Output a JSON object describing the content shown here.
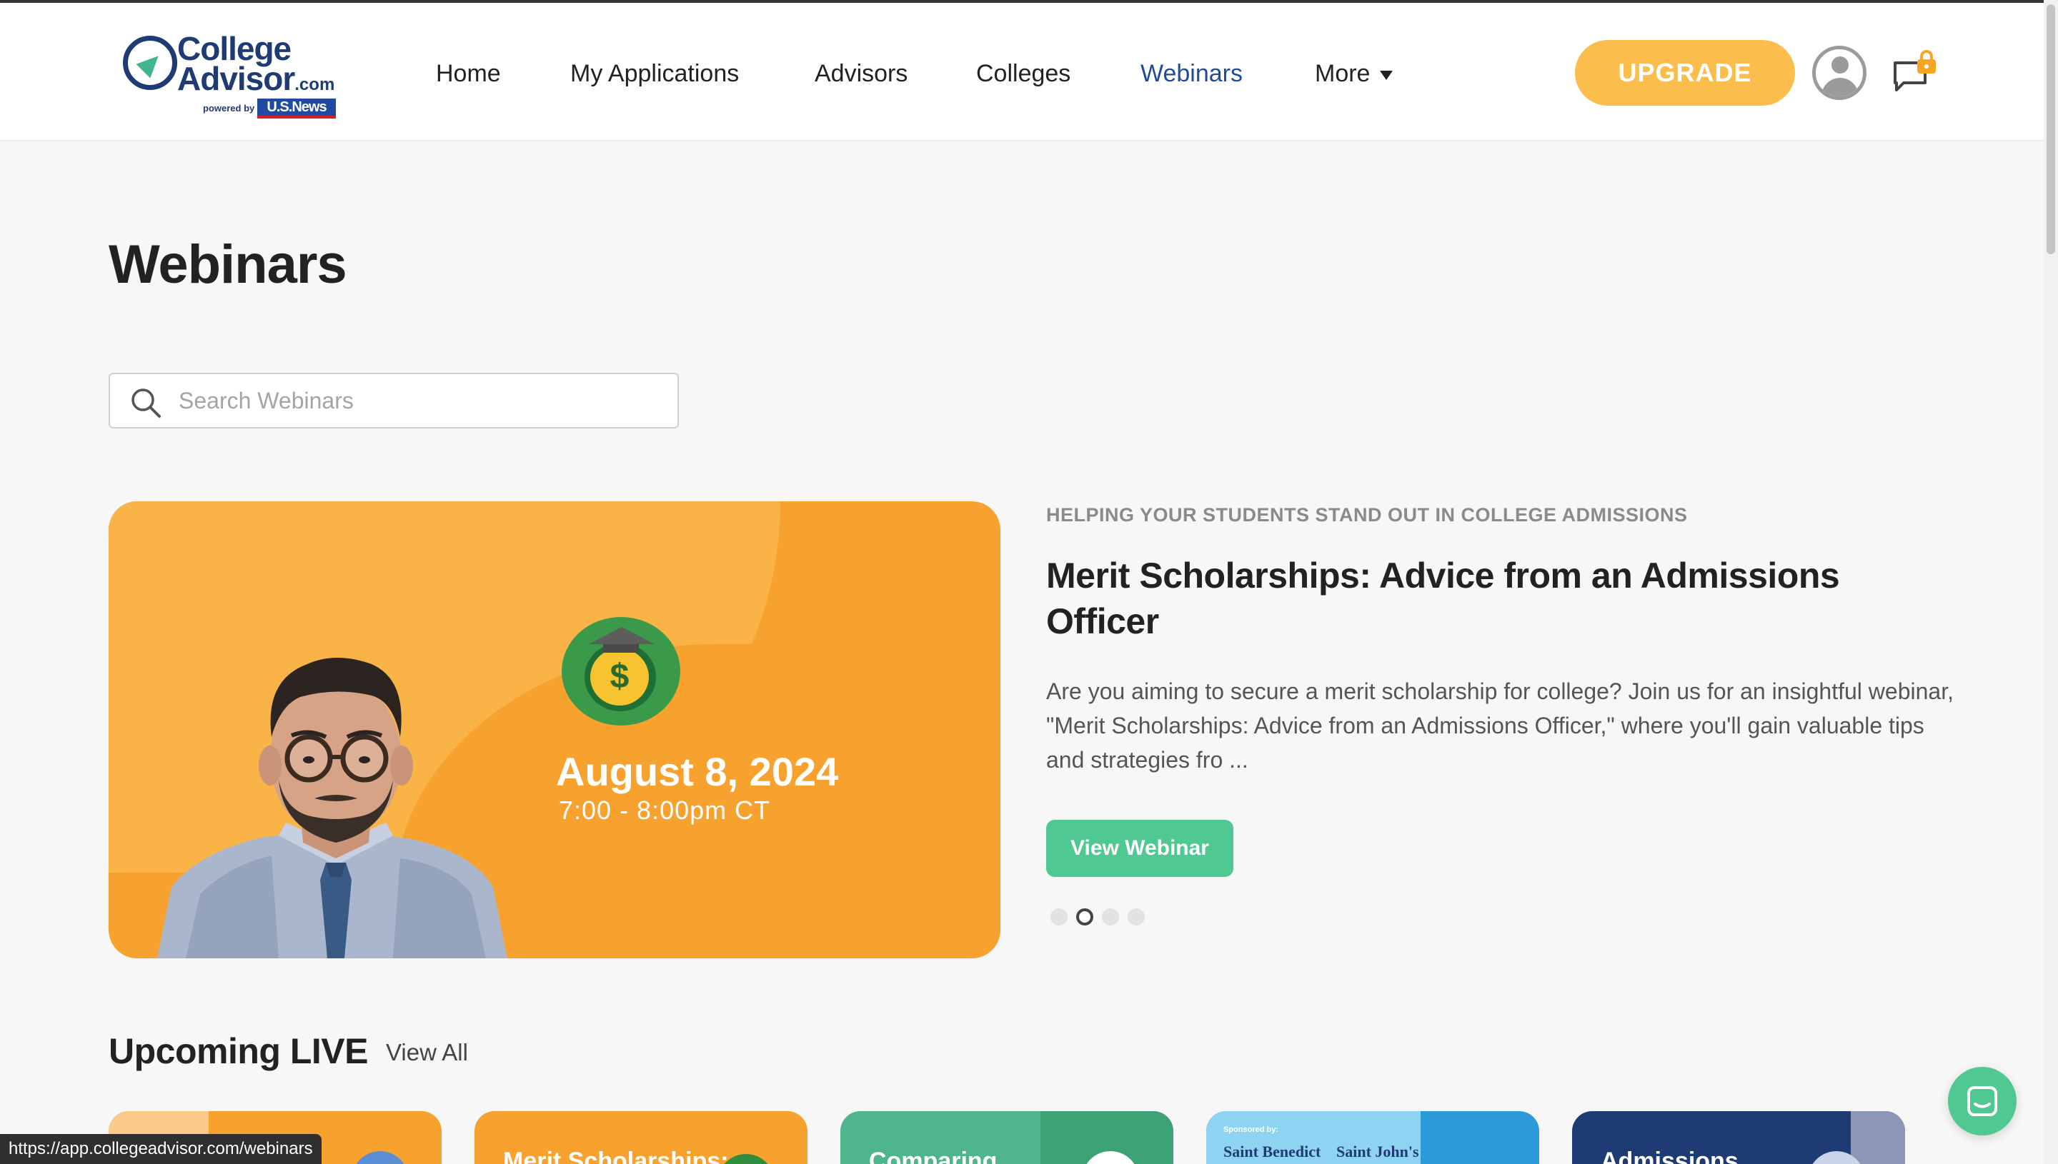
{
  "brand": {
    "line1": "College",
    "line2": "Advisor",
    "dotcom": ".com",
    "powered_by": "powered by",
    "partner": "U.S.News"
  },
  "nav": {
    "items": [
      {
        "label": "Home",
        "active": false
      },
      {
        "label": "My Applications",
        "active": false
      },
      {
        "label": "Advisors",
        "active": false
      },
      {
        "label": "Colleges",
        "active": false
      },
      {
        "label": "Webinars",
        "active": true
      },
      {
        "label": "More",
        "active": false
      }
    ],
    "upgrade_label": "UPGRADE"
  },
  "page": {
    "title": "Webinars"
  },
  "search": {
    "placeholder": "Search Webinars",
    "value": ""
  },
  "featured": {
    "date": "August 8, 2024",
    "time": "7:00 - 8:00pm CT",
    "coin_symbol": "$",
    "kicker": "HELPING YOUR STUDENTS STAND OUT IN COLLEGE ADMISSIONS",
    "title": "Merit Scholarships: Advice from an Admissions Officer",
    "description": "Are you aiming to secure a merit scholarship for college? Join us for an insightful webinar, \"Merit Scholarships: Advice from an Admissions Officer,\" where you'll gain valuable tips and strategies fro ...",
    "button_label": "View Webinar",
    "slide_count": 4,
    "active_slide": 2
  },
  "upcoming": {
    "title": "Upcoming LIVE",
    "view_all": "View All",
    "cards": [
      {
        "label": "",
        "color": "#f7a12f"
      },
      {
        "label": "Merit Scholarships:",
        "color": "#f7a12f"
      },
      {
        "label": "Comparing",
        "color": "#4fb58c"
      },
      {
        "label": "",
        "sponsor": "Sponsored by:",
        "school1": "Saint Benedict",
        "school2": "Saint John's",
        "color": "#2a9ad9"
      },
      {
        "label": "Admissions",
        "color": "#1f3b73"
      }
    ]
  },
  "status_url": "https://app.collegeadvisor.com/webinars",
  "colors": {
    "brand_navy": "#1f3b73",
    "accent_green": "#4fc892",
    "upgrade_orange": "#fbbd4b",
    "hero_orange": "#f7a12f",
    "active_nav": "#1f4c9a"
  },
  "icons": [
    "logo-arrow-icon",
    "chevron-down-icon",
    "user-avatar-icon",
    "chat-icon",
    "lock-icon",
    "search-icon",
    "graduation-coin-icon",
    "messenger-icon"
  ]
}
